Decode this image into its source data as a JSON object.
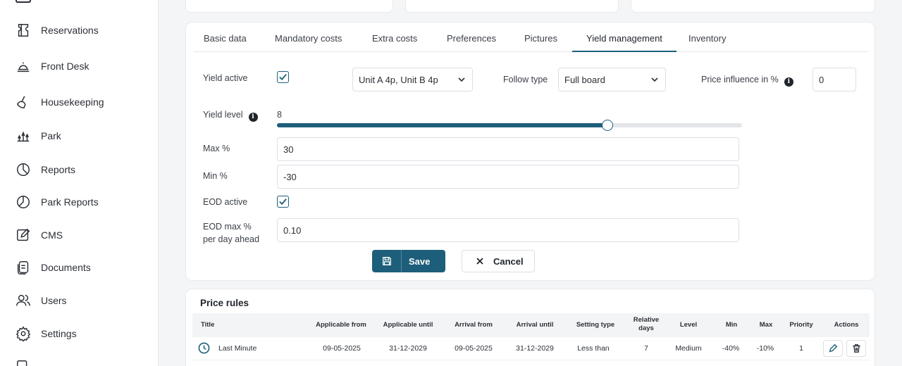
{
  "sidebar": {
    "items": [
      {
        "label": "Reservations",
        "icon": "reservations-icon"
      },
      {
        "label": "Front Desk",
        "icon": "bell-icon"
      },
      {
        "label": "Housekeeping",
        "icon": "broom-icon"
      },
      {
        "label": "Park",
        "icon": "park-icon"
      },
      {
        "label": "Reports",
        "icon": "pie-chart-icon"
      },
      {
        "label": "Park Reports",
        "icon": "pie-chart-icon"
      },
      {
        "label": "CMS",
        "icon": "edit-icon"
      },
      {
        "label": "Documents",
        "icon": "documents-icon"
      },
      {
        "label": "Users",
        "icon": "users-icon"
      },
      {
        "label": "Settings",
        "icon": "gear-icon"
      }
    ]
  },
  "tabs": [
    {
      "label": "Basic data"
    },
    {
      "label": "Mandatory costs"
    },
    {
      "label": "Extra costs"
    },
    {
      "label": "Preferences"
    },
    {
      "label": "Pictures"
    },
    {
      "label": "Yield management",
      "active": true
    },
    {
      "label": "Inventory"
    }
  ],
  "form": {
    "yield_active_label": "Yield active",
    "yield_active_checked": true,
    "units_value": "Unit A 4p, Unit B 4p",
    "follow_type_label": "Follow type",
    "follow_type_value": "Full board",
    "price_influence_label": "Price influence in %",
    "price_influence_value": "0",
    "yield_level_label": "Yield level",
    "yield_level_value": "8",
    "yield_level_fraction": 0.71,
    "max_label": "Max %",
    "max_value": "30",
    "min_label": "Min %",
    "min_value": "-30",
    "eod_active_label": "EOD active",
    "eod_active_checked": true,
    "eod_max_label_line1": "EOD max %",
    "eod_max_label_line2": "per day ahead",
    "eod_max_value": "0.10",
    "save_label": "Save",
    "cancel_label": "Cancel"
  },
  "price_rules": {
    "title": "Price rules",
    "columns": {
      "title": "Title",
      "applicable_from": "Applicable from",
      "applicable_until": "Applicable until",
      "arrival_from": "Arrival from",
      "arrival_until": "Arrival until",
      "setting_type": "Setting type",
      "relative_days_1": "Relative",
      "relative_days_2": "days",
      "level": "Level",
      "min": "Min",
      "max": "Max",
      "priority": "Priority",
      "actions": "Actions"
    },
    "rows": [
      {
        "title": "Last Minute",
        "applicable_from": "09-05-2025",
        "applicable_until": "31-12-2029",
        "arrival_from": "09-05-2025",
        "arrival_until": "31-12-2029",
        "setting_type": "Less than",
        "relative_days": "7",
        "level": "Medium",
        "min": "-40%",
        "max": "-10%",
        "priority": "1"
      }
    ]
  },
  "colors": {
    "accent": "#1d5f7a",
    "text": "#2b2f36",
    "border": "#dcdfe4",
    "background": "#f4f5f7"
  }
}
